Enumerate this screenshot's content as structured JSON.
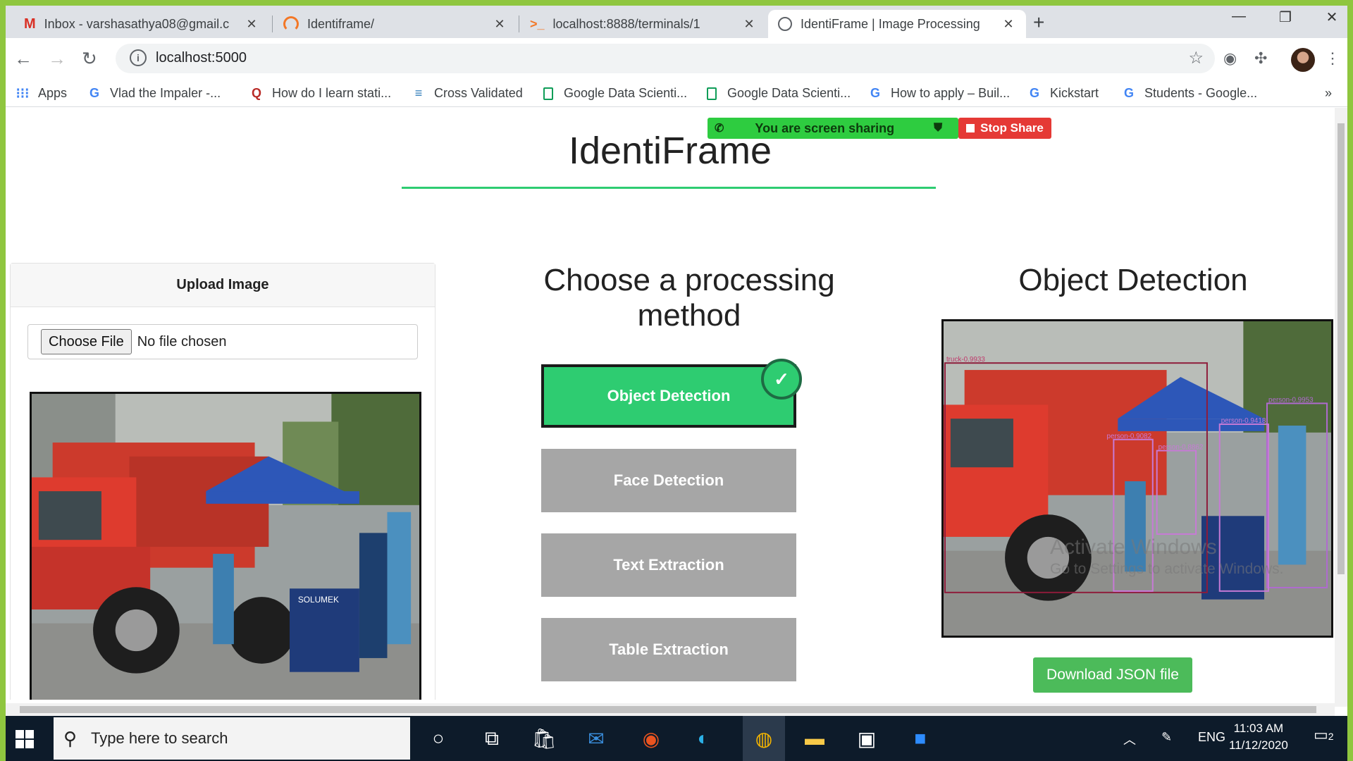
{
  "browser": {
    "tabs": [
      {
        "title": "Inbox - varshasathya08@gmail.c",
        "icon": "gmail-icon",
        "active": false
      },
      {
        "title": "Identiframe/",
        "icon": "jupyter-icon",
        "active": false
      },
      {
        "title": "localhost:8888/terminals/1",
        "icon": "terminal-icon",
        "active": false
      },
      {
        "title": "IdentiFrame | Image Processing",
        "icon": "globe-icon",
        "active": true
      }
    ],
    "close_glyph": "✕",
    "new_tab_glyph": "+",
    "url": "localhost:5000",
    "bookmarks": [
      {
        "label": "Apps",
        "icon": "apps-grid-icon"
      },
      {
        "label": "Vlad the Impaler -...",
        "icon": "google-icon"
      },
      {
        "label": "How do I learn stati...",
        "icon": "quora-icon"
      },
      {
        "label": "Cross Validated",
        "icon": "stackexchange-icon"
      },
      {
        "label": "Google Data Scienti...",
        "icon": "doc-icon"
      },
      {
        "label": "Google Data Scienti...",
        "icon": "doc-icon"
      },
      {
        "label": "How to apply – Buil...",
        "icon": "google-icon"
      },
      {
        "label": "Kickstart",
        "icon": "google-icon"
      },
      {
        "label": "Students - Google...",
        "icon": "google-icon"
      }
    ],
    "bookmarks_overflow": "»"
  },
  "screen_share": {
    "message": "You are screen sharing",
    "stop_label": "Stop Share"
  },
  "page": {
    "title": "IdentiFrame",
    "upload": {
      "header": "Upload Image",
      "choose_label": "Choose File",
      "file_status": "No file chosen"
    },
    "methods": {
      "heading": "Choose a processing method",
      "items": [
        {
          "label": "Object Detection",
          "selected": true
        },
        {
          "label": "Face Detection",
          "selected": false
        },
        {
          "label": "Text Extraction",
          "selected": false
        },
        {
          "label": "Table Extraction",
          "selected": false
        }
      ],
      "check_glyph": "✓"
    },
    "result": {
      "heading": "Object Detection",
      "download_label": "Download JSON file",
      "detections": [
        {
          "label": "truck-0.9933"
        },
        {
          "label": "person-0.9953"
        },
        {
          "label": "person-0.9418"
        },
        {
          "label": "person-0.9082"
        },
        {
          "label": "person-0.8862"
        }
      ]
    },
    "scene_sign": "SOLUMEK"
  },
  "watermark": {
    "line1": "Activate Windows",
    "line2": "Go to Settings to activate Windows."
  },
  "taskbar": {
    "search_placeholder": "Type here to search",
    "language": "ENG",
    "time": "11:03 AM",
    "date": "11/12/2020",
    "notification_count": "2"
  },
  "colors": {
    "accent_green": "#2ecc71",
    "button_gray": "#a6a6a6",
    "download_green": "#4cbb5a",
    "stop_red": "#e53935",
    "frame_green": "#8fc63f"
  }
}
